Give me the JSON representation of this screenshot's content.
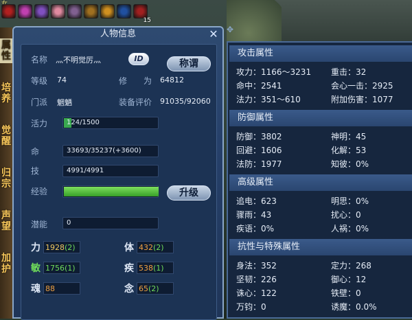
{
  "topbar": {
    "text": "女",
    "buffs": [
      {
        "icon": "red-mask-icon",
        "color": "#b02020"
      },
      {
        "icon": "pink-star-icon",
        "color": "#c040b0"
      },
      {
        "icon": "violet-swirl-icon",
        "color": "#8050c0"
      },
      {
        "icon": "cherry-blossom-icon",
        "color": "#e08aa0"
      },
      {
        "icon": "figure-icon",
        "color": "#806090"
      },
      {
        "icon": "vip-9-icon",
        "color": "#a07020"
      },
      {
        "icon": "gold-emblem-icon",
        "color": "#d09020"
      },
      {
        "icon": "blue-swords-icon",
        "color": "#2050a0"
      },
      {
        "icon": "red-slash-icon",
        "color": "#a02020",
        "count": "15"
      }
    ]
  },
  "sidetabs": [
    {
      "label": "属性",
      "active": true
    },
    {
      "label": "培养",
      "active": false
    },
    {
      "label": "觉醒",
      "active": false
    },
    {
      "label": "归宗",
      "active": false
    },
    {
      "label": "声望",
      "active": false
    },
    {
      "label": "加护",
      "active": false
    }
  ],
  "panel": {
    "title": "人物信息",
    "name_label": "名称",
    "name_value": "灬不明觉厉灬",
    "id_button": "ID",
    "title_button": "称谓",
    "level_label": "等级",
    "level_value": "74",
    "cultivation_label": "修　　为",
    "cultivation_value": "64812",
    "sect_label": "门派",
    "sect_value": "魍魉",
    "gear_label": "装备评价",
    "gear_value": "91035/92060",
    "vitality_label": "活力",
    "vitality_value": "124/1500",
    "vitality_fraction": 0.083,
    "hp_label": "命",
    "hp_value": "33693/35237(+3600)",
    "skill_label": "技",
    "skill_value": "4991/4991",
    "exp_label": "经验",
    "exp_fraction": 1.0,
    "upgrade_button": "升级",
    "potential_label": "潜能",
    "potential_value": "0",
    "stats": [
      {
        "label": "力",
        "value": "1928",
        "bonus": "(2)",
        "green": false,
        "orange": false
      },
      {
        "label": "体",
        "value": "432",
        "bonus": "(2)",
        "green": false,
        "orange": true
      },
      {
        "label": "敏",
        "value": "1756",
        "bonus": "(1)",
        "green": true,
        "orange": false
      },
      {
        "label": "疾",
        "value": "538",
        "bonus": "(1)",
        "green": false,
        "orange": true
      },
      {
        "label": "魂",
        "value": "88",
        "bonus": "",
        "green": false,
        "orange": true
      },
      {
        "label": "念",
        "value": "65",
        "bonus": "(2)",
        "green": false,
        "orange": true
      }
    ]
  },
  "attributes": {
    "sections": [
      {
        "title": "攻击属性",
        "rows": [
          [
            "攻力：1166～3231",
            "重击：32"
          ],
          [
            "命中：2541",
            "会心一击：2925"
          ],
          [
            "法力：351～610",
            "附加伤害：1077"
          ]
        ]
      },
      {
        "title": "防御属性",
        "rows": [
          [
            "防御：3802",
            "神明：45"
          ],
          [
            "回避：1606",
            "化解：53"
          ],
          [
            "法防：1977",
            "知彼：0%"
          ]
        ]
      },
      {
        "title": "高级属性",
        "rows": [
          [
            "追电：623",
            "明思：0%"
          ],
          [
            "骤雨：43",
            "扰心：0"
          ],
          [
            "疾语：0%",
            "人祸：0%"
          ]
        ]
      },
      {
        "title": "抗性与特殊属性",
        "rows": [
          [
            "身法：352",
            "定力：268"
          ],
          [
            "坚韧：226",
            "御心：12"
          ],
          [
            "诛心：122",
            "铁壁：0"
          ],
          [
            "万钧：0",
            "诱魔：0.0%"
          ]
        ]
      }
    ]
  }
}
